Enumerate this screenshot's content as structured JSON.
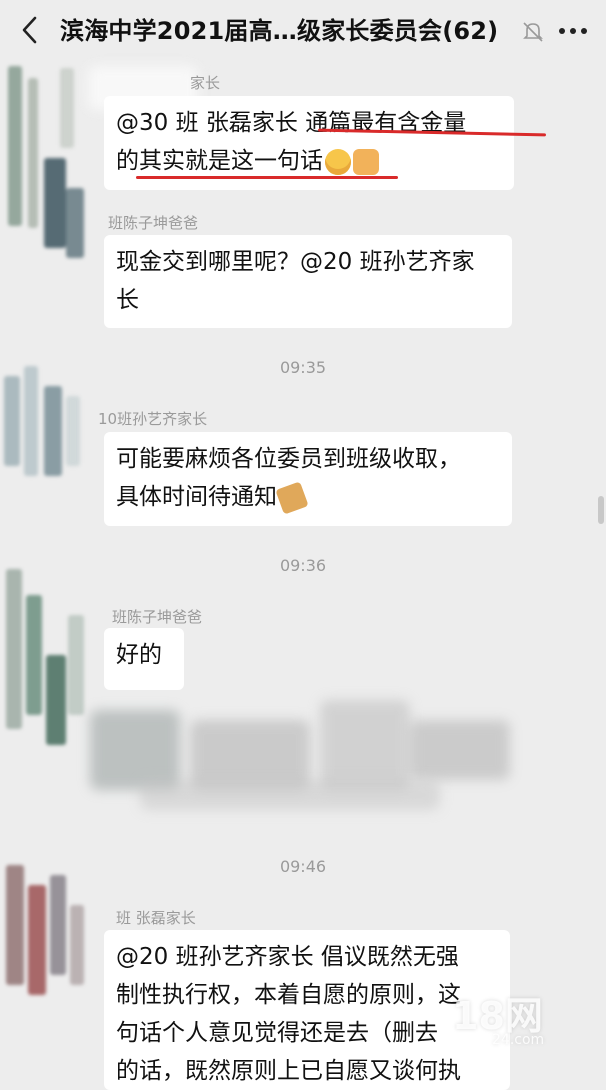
{
  "header": {
    "title": "滨海中学2021届高…级家长委员会(62)",
    "icons": [
      "back-icon",
      "mute-bell-icon",
      "more-icon"
    ]
  },
  "messages": [
    {
      "sender": "家长",
      "text_line1": "@30 班 张磊家长  通篇最有含金量",
      "text_line2": "的其实就是这一句话",
      "emoji": [
        "grinning-face",
        "thumbs-up"
      ]
    },
    {
      "sender": "班陈子坤爸爸",
      "text_line1": "现金交到哪里呢？@20 班孙艺齐家",
      "text_line2": "长"
    },
    {
      "time": "09:35"
    },
    {
      "sender": "10班孙艺齐家长",
      "text_line1": "可能要麻烦各位委员到班级收取，",
      "text_line2": "具体时间待通知",
      "emoji": [
        "folded-hands"
      ]
    },
    {
      "time": "09:36"
    },
    {
      "sender": "班陈子坤爸爸",
      "text_line1": "好的"
    },
    {
      "time": "09:46"
    },
    {
      "sender": "班 张磊家长",
      "text_line1": "@20 班孙艺齐家长  倡议既然无强",
      "text_line2": "制性执行权，本着自愿的原则，这",
      "text_line3": "句话个人意见觉得还是去（删去",
      "text_line4": "的话，既然原则上已自愿又谈何执"
    }
  ],
  "watermark": {
    "main": "18网",
    "sub": "24.com"
  },
  "colors": {
    "background": "#ededed",
    "bubble": "#ffffff",
    "meta_text": "#9a9a9a",
    "underline": "#d92a2a"
  }
}
